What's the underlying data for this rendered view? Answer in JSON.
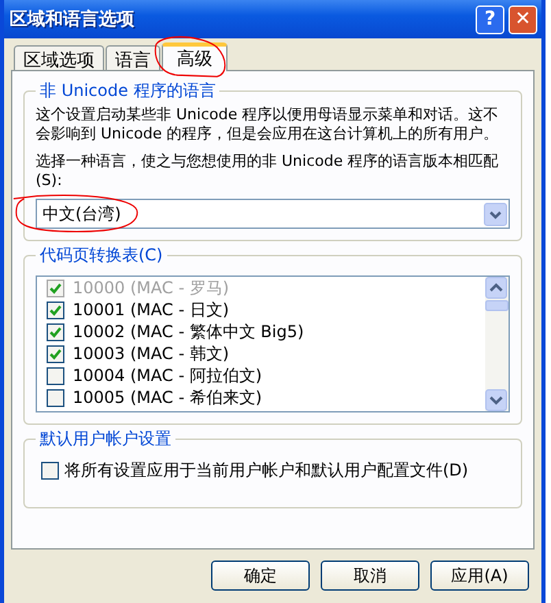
{
  "window": {
    "title": "区域和语言选项",
    "help_button": "?",
    "close_button": "✕"
  },
  "tabs": [
    {
      "label": "区域选项",
      "selected": false
    },
    {
      "label": "语言",
      "selected": false
    },
    {
      "label": "高级",
      "selected": true
    }
  ],
  "non_unicode_group": {
    "title": "非 Unicode 程序的语言",
    "description": "这个设置启动某些非 Unicode 程序以便用母语显示菜单和对话。这不会影响到 Unicode 的程序，但是会应用在这台计算机上的所有用户。",
    "prompt": "选择一种语言，使之与您想使用的非 Unicode 程序的语言版本相匹配(S):",
    "dropdown": {
      "value": "中文(台湾)"
    }
  },
  "code_page_group": {
    "title": "代码页转换表(C)",
    "items": [
      {
        "label": "10000 (MAC - 罗马)",
        "checked": true,
        "disabled": true
      },
      {
        "label": "10001 (MAC - 日文)",
        "checked": true,
        "disabled": false
      },
      {
        "label": "10002 (MAC - 繁体中文 Big5)",
        "checked": true,
        "disabled": false
      },
      {
        "label": "10003 (MAC - 韩文)",
        "checked": true,
        "disabled": false
      },
      {
        "label": "10004 (MAC - 阿拉伯文)",
        "checked": false,
        "disabled": false
      },
      {
        "label": "10005 (MAC - 希伯来文)",
        "checked": false,
        "disabled": false
      }
    ]
  },
  "default_user_group": {
    "title": "默认用户帐户设置",
    "checkbox": {
      "label": "将所有设置应用于当前用户帐户和默认用户配置文件(D)",
      "checked": false
    }
  },
  "buttons": [
    "确定",
    "取消",
    "应用(A)"
  ]
}
